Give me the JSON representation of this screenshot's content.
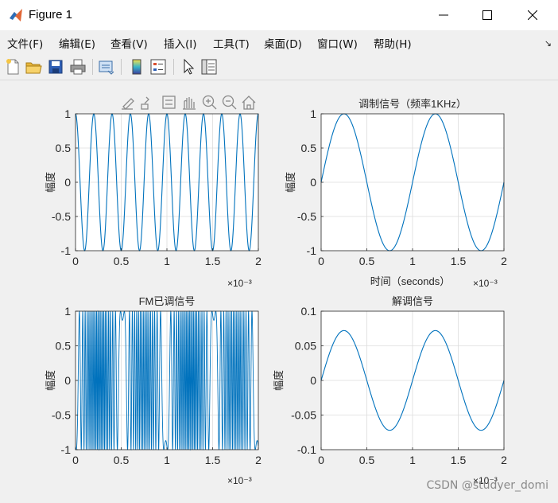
{
  "window": {
    "title": "Figure 1"
  },
  "menu": {
    "items": [
      "文件(F)",
      "编辑(E)",
      "查看(V)",
      "插入(I)",
      "工具(T)",
      "桌面(D)",
      "窗口(W)",
      "帮助(H)"
    ]
  },
  "toolbar": {
    "icons": [
      "new-figure-icon",
      "open-file-icon",
      "save-icon",
      "print-icon",
      "link-icon",
      "colorbar-icon",
      "legend-icon",
      "pointer-icon",
      "property-inspector-icon"
    ]
  },
  "axes_toolbar": {
    "icons": [
      "brush-edit-icon",
      "data-brush-icon",
      "datatip-icon",
      "pan-hand-icon",
      "zoom-in-icon",
      "zoom-out-icon",
      "home-icon"
    ]
  },
  "line_color": "#0072BD",
  "chart_data": [
    {
      "type": "line",
      "title": "",
      "xlabel": "",
      "ylabel": "幅度",
      "x_exponent": "×10⁻³",
      "xlim": [
        0,
        0.002
      ],
      "ylim": [
        -1,
        1
      ],
      "xticks": [
        "0",
        "0.5",
        "1",
        "1.5",
        "2"
      ],
      "yticks": [
        "-1",
        "-0.5",
        "0",
        "0.5",
        "1"
      ],
      "grid": true,
      "series": [
        {
          "function": "cos",
          "frequency_hz": 5000,
          "amplitude": 1
        }
      ]
    },
    {
      "type": "line",
      "title": "调制信号（频率1KHz）",
      "xlabel": "时间（seconds）",
      "ylabel": "幅度",
      "x_exponent": "×10⁻³",
      "xlim": [
        0,
        0.002
      ],
      "ylim": [
        -1,
        1
      ],
      "xticks": [
        "0",
        "0.5",
        "1",
        "1.5",
        "2"
      ],
      "yticks": [
        "-1",
        "-0.5",
        "0",
        "0.5",
        "1"
      ],
      "grid": true,
      "series": [
        {
          "function": "sin",
          "frequency_hz": 1000,
          "amplitude": 1
        }
      ]
    },
    {
      "type": "line",
      "title": "FM已调信号",
      "xlabel": "",
      "ylabel": "幅度",
      "x_exponent": "×10⁻³",
      "xlim": [
        0,
        0.002
      ],
      "ylim": [
        -1,
        1
      ],
      "xticks": [
        "0",
        "0.5",
        "1",
        "1.5",
        "2"
      ],
      "yticks": [
        "-1",
        "-0.5",
        "0",
        "0.5",
        "1"
      ],
      "grid": true,
      "series": [
        {
          "function": "fm",
          "carrier_hz": 5000,
          "message_hz": 1000,
          "amplitude": 1
        }
      ]
    },
    {
      "type": "line",
      "title": "解调信号",
      "xlabel": "",
      "ylabel": "幅度",
      "x_exponent": "×10⁻³",
      "xlim": [
        0,
        0.002
      ],
      "ylim": [
        -0.1,
        0.1
      ],
      "xticks": [
        "0",
        "0.5",
        "1",
        "1.5",
        "2"
      ],
      "yticks": [
        "-0.1",
        "-0.05",
        "0",
        "0.05",
        "0.1"
      ],
      "grid": true,
      "series": [
        {
          "function": "sin",
          "frequency_hz": 1000,
          "amplitude": 0.072
        }
      ]
    }
  ],
  "watermark": "CSDN @studyer_domi"
}
